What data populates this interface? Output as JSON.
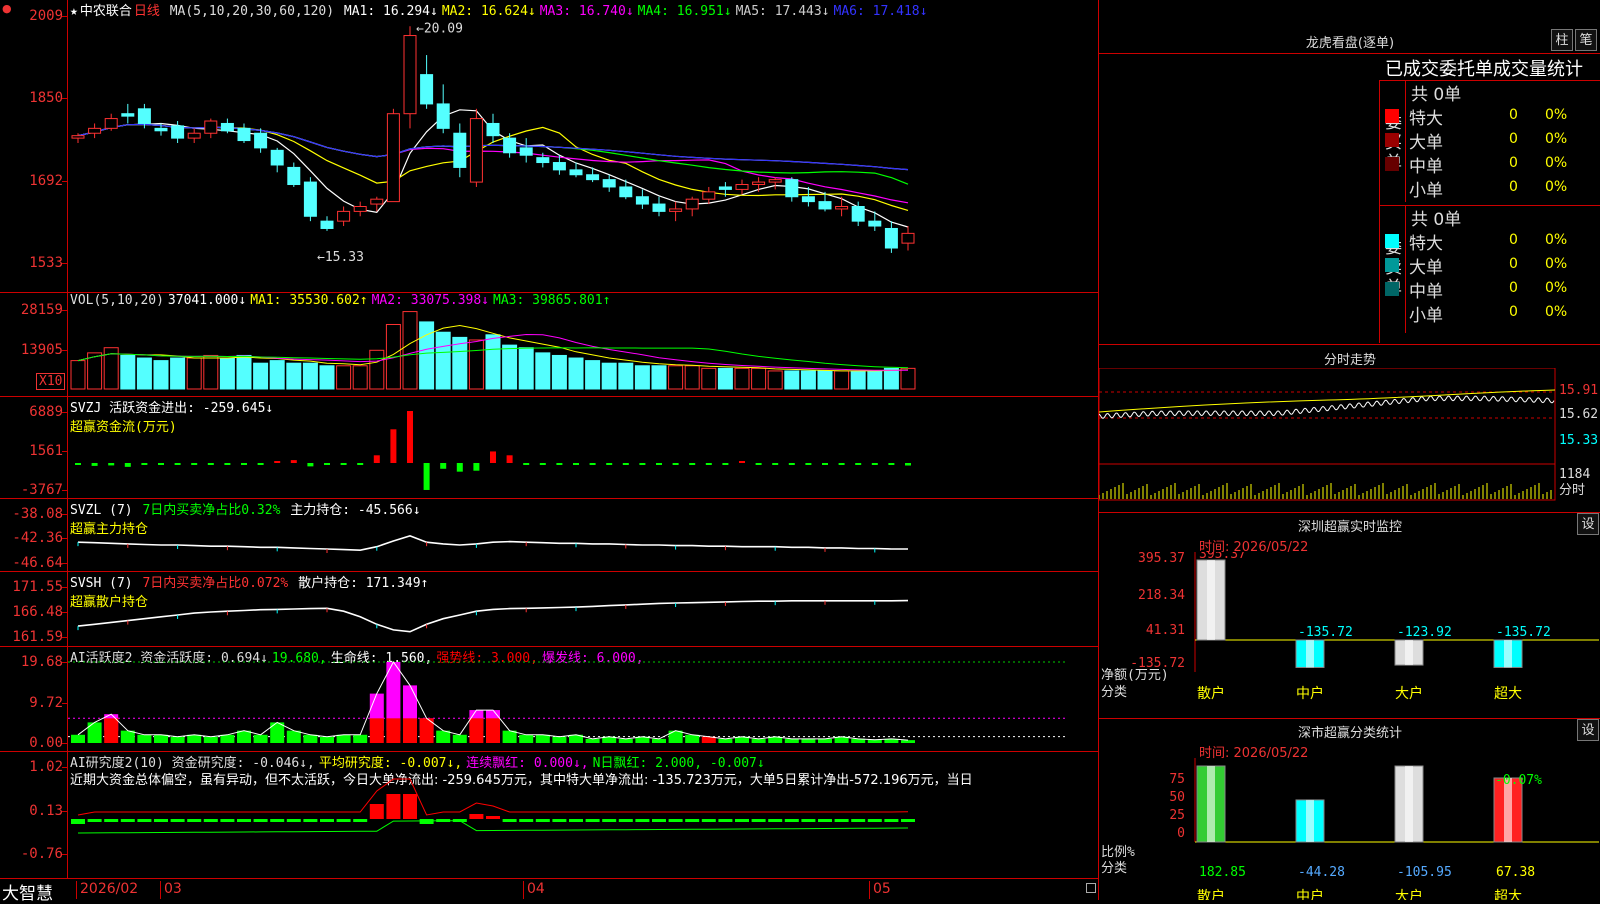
{
  "header": {
    "star": "★",
    "stock_name": "中农联合",
    "period": "日线",
    "ma_label": "MA(5,10,20,30,60,120)",
    "ma": [
      {
        "label": "MA1:",
        "value": "16.294",
        "arrow": "↓",
        "color": "#ffffff"
      },
      {
        "label": "MA2:",
        "value": "16.624",
        "arrow": "↓",
        "color": "#ffff00"
      },
      {
        "label": "MA3:",
        "value": "16.740",
        "arrow": "↓",
        "color": "#ff00ff"
      },
      {
        "label": "MA4:",
        "value": "16.951",
        "arrow": "↓",
        "color": "#00ff00"
      },
      {
        "label": "MA5:",
        "value": "17.443",
        "arrow": "↓",
        "color": "#cccccc"
      },
      {
        "label": "MA6:",
        "value": "17.418",
        "arrow": "↓",
        "color": "#3333ff"
      }
    ],
    "high_label": "20.09",
    "low_label": "15.33",
    "corner_mark": "●"
  },
  "left_axis": {
    "price": [
      "2009",
      "1850",
      "1692",
      "1533"
    ],
    "vol": [
      "28159",
      "13905"
    ],
    "vol_unit": "X10",
    "svzj": [
      "6889",
      "1561",
      "-3767"
    ],
    "svzl": [
      "-38.08",
      "-42.36",
      "-46.64"
    ],
    "svsh": [
      "171.55",
      "166.48",
      "161.59"
    ],
    "ai1": [
      "19.68",
      "9.72",
      "0.00"
    ],
    "ai2": [
      "1.02",
      "0.13",
      "-0.76"
    ]
  },
  "vol_legend": [
    {
      "text": "VOL(5,10,20)",
      "color": "#dddddd"
    },
    {
      "text": "37041.000↓",
      "color": "#ffffff"
    },
    {
      "text": "MA1: 35530.602↑",
      "color": "#ffff00"
    },
    {
      "text": "MA2: 33075.398↓",
      "color": "#ff00ff"
    },
    {
      "text": "MA3: 39865.801↑",
      "color": "#00ff00"
    }
  ],
  "svzj_legend": {
    "line1": "SVZJ  活跃资金进出: -259.645↓",
    "line2": "超赢资金流(万元)"
  },
  "svzl_legend": {
    "a": "SVZL (7)",
    "b": "7日内买卖净占比0.32%",
    "c": "主力持仓: -45.566↓",
    "line2": "超赢主力持仓"
  },
  "svsh_legend": {
    "a": "SVSH (7)",
    "b": "7日内买卖净占比0.072%",
    "c": "散户持仓: 171.349↑",
    "line2": "超赢散户持仓"
  },
  "ai1_legend": [
    {
      "text": "AI活跃度2 资金活跃度: 0.694↓",
      "color": "#dddddd"
    },
    {
      "text": "19.680,",
      "color": "#00ff00"
    },
    {
      "text": "生命线: 1.560,",
      "color": "#ffffff"
    },
    {
      "text": "强势线: 3.000,",
      "color": "#ff0000"
    },
    {
      "text": "爆发线: 6.000,",
      "color": "#ff00ff"
    }
  ],
  "ai2_legend": [
    {
      "text": "AI研究度2(10) 资金研究度: -0.046↓,",
      "color": "#dddddd"
    },
    {
      "text": "平均研究度: -0.007↓,",
      "color": "#ffff00"
    },
    {
      "text": "连续飘红: 0.000↓,",
      "color": "#ff00ff"
    },
    {
      "text": "N日飘红: 2.000, -0.007↓",
      "color": "#00ff00"
    }
  ],
  "ai2_text": "近期大资金总体偏空，虽有异动，但不太活跃，今日大单净流出: -259.645万元，其中特大单净流出: -135.723万元，大单5日累计净出-572.196万元，当日",
  "bottom": {
    "logo": "大智慧",
    "dates": [
      "2026/02",
      "03",
      "04",
      "05"
    ]
  },
  "right": {
    "title": "龙虎看盘(逐单)",
    "btn1": "柱",
    "btn2": "笔",
    "subtitle": "已成交委托单成交量统计",
    "buy": {
      "side": [
        "委",
        "买",
        "单"
      ],
      "total": "共 0单",
      "rows": [
        {
          "label": "特大",
          "val": "0",
          "pct": "0%",
          "color": "#ff0000"
        },
        {
          "label": "大单",
          "val": "0",
          "pct": "0%",
          "color": "#990000"
        },
        {
          "label": "中单",
          "val": "0",
          "pct": "0%",
          "color": "#660000"
        },
        {
          "label": "小单",
          "val": "0",
          "pct": "0%",
          "color": ""
        }
      ]
    },
    "sell": {
      "side": [
        "委",
        "卖",
        "单"
      ],
      "total": "共 0单",
      "rows": [
        {
          "label": "特大",
          "val": "0",
          "pct": "0%",
          "color": "#00ffff"
        },
        {
          "label": "大单",
          "val": "0",
          "pct": "0%",
          "color": "#009999"
        },
        {
          "label": "中单",
          "val": "0",
          "pct": "0%",
          "color": "#006666"
        },
        {
          "label": "小单",
          "val": "0",
          "pct": "0%",
          "color": ""
        }
      ]
    },
    "intraday": {
      "title": "分时走势",
      "labels": [
        "15.91",
        "15.62",
        "15.33",
        "1184",
        "分时"
      ]
    },
    "sz_monitor": {
      "title": "深圳超赢实时监控",
      "btn": "设",
      "time": "时间: 2026/05/22",
      "ylabels": [
        "395.37",
        "218.34",
        "41.31",
        "-135.72"
      ],
      "ytitle": "净额(万元)",
      "xtitle": "分类",
      "cats": [
        "散户",
        "中户",
        "大户",
        "超大"
      ],
      "values": [
        "395.37",
        "-135.72",
        "-123.92",
        "-135.72"
      ]
    },
    "sz_class": {
      "title": "深市超赢分类统计",
      "btn": "设",
      "time": "时间: 2026/05/22",
      "ylabels": [
        "75",
        "50",
        "25",
        "0"
      ],
      "ytitle": "比例%",
      "xtitle": "分类",
      "cats": [
        "散户",
        "中户",
        "大户",
        "超大"
      ],
      "values": [
        "182.85",
        "-44.28",
        "-105.95",
        "67.38"
      ],
      "top_label": "-0.07%"
    }
  },
  "chart_data": [
    {
      "type": "candlestick",
      "title": "中农联合 日线",
      "ylim": [
        15.33,
        20.09
      ],
      "note_high": 20.09,
      "note_low": 15.33,
      "ohlc": [
        [
          17.8,
          17.9,
          17.7,
          17.85
        ],
        [
          17.9,
          18.1,
          17.8,
          18.0
        ],
        [
          18.0,
          18.3,
          17.95,
          18.2
        ],
        [
          18.3,
          18.5,
          18.1,
          18.25
        ],
        [
          18.4,
          18.5,
          18.0,
          18.1
        ],
        [
          18.0,
          18.1,
          17.85,
          17.95
        ],
        [
          18.05,
          18.15,
          17.7,
          17.8
        ],
        [
          17.8,
          18.0,
          17.7,
          17.9
        ],
        [
          17.9,
          18.2,
          17.8,
          18.15
        ],
        [
          18.1,
          18.2,
          17.9,
          17.95
        ],
        [
          18.0,
          18.1,
          17.7,
          17.75
        ],
        [
          17.9,
          18.0,
          17.5,
          17.6
        ],
        [
          17.55,
          17.6,
          17.1,
          17.25
        ],
        [
          17.2,
          17.3,
          16.8,
          16.85
        ],
        [
          16.9,
          17.0,
          16.1,
          16.2
        ],
        [
          16.1,
          16.2,
          15.9,
          15.95
        ],
        [
          16.1,
          16.4,
          16.0,
          16.3
        ],
        [
          16.3,
          16.5,
          16.2,
          16.4
        ],
        [
          16.45,
          16.6,
          16.3,
          16.55
        ],
        [
          16.5,
          18.4,
          16.5,
          18.3
        ],
        [
          18.3,
          20.09,
          18.0,
          19.9
        ],
        [
          19.1,
          19.5,
          18.4,
          18.5
        ],
        [
          18.5,
          18.9,
          17.9,
          18.0
        ],
        [
          17.9,
          18.1,
          17.0,
          17.2
        ],
        [
          16.9,
          18.4,
          16.8,
          18.2
        ],
        [
          18.1,
          18.3,
          17.7,
          17.85
        ],
        [
          17.8,
          17.9,
          17.4,
          17.5
        ],
        [
          17.6,
          17.8,
          17.3,
          17.45
        ],
        [
          17.4,
          17.5,
          17.2,
          17.3
        ],
        [
          17.3,
          17.45,
          17.05,
          17.15
        ],
        [
          17.15,
          17.3,
          17.0,
          17.05
        ],
        [
          17.05,
          17.2,
          16.9,
          16.95
        ],
        [
          16.95,
          17.05,
          16.7,
          16.8
        ],
        [
          16.8,
          16.95,
          16.55,
          16.6
        ],
        [
          16.6,
          16.75,
          16.35,
          16.45
        ],
        [
          16.45,
          16.6,
          16.2,
          16.3
        ],
        [
          16.3,
          16.5,
          16.1,
          16.35
        ],
        [
          16.35,
          16.6,
          16.2,
          16.55
        ],
        [
          16.55,
          16.8,
          16.45,
          16.7
        ],
        [
          16.8,
          16.9,
          16.6,
          16.75
        ],
        [
          16.75,
          16.95,
          16.65,
          16.85
        ],
        [
          16.85,
          17.0,
          16.7,
          16.9
        ],
        [
          16.9,
          17.0,
          16.75,
          16.95
        ],
        [
          16.95,
          17.0,
          16.5,
          16.6
        ],
        [
          16.6,
          16.8,
          16.4,
          16.5
        ],
        [
          16.5,
          16.7,
          16.3,
          16.35
        ],
        [
          16.35,
          16.6,
          16.2,
          16.4
        ],
        [
          16.4,
          16.5,
          16.0,
          16.1
        ],
        [
          16.1,
          16.3,
          15.9,
          16.0
        ],
        [
          15.95,
          16.1,
          15.45,
          15.55
        ],
        [
          15.65,
          16.0,
          15.5,
          15.85
        ]
      ]
    },
    {
      "type": "bar",
      "title": "VOL",
      "values": [
        1.1,
        1.4,
        1.6,
        1.3,
        1.2,
        1.1,
        1.2,
        1.2,
        1.3,
        1.2,
        1.3,
        1.0,
        1.1,
        1.0,
        1.0,
        0.9,
        0.9,
        0.9,
        1.5,
        2.5,
        3.0,
        2.6,
        2.2,
        2.0,
        1.9,
        2.1,
        1.7,
        1.6,
        1.4,
        1.3,
        1.2,
        1.1,
        1.0,
        1.0,
        0.9,
        0.9,
        0.9,
        0.9,
        0.8,
        0.8,
        0.8,
        0.8,
        0.7,
        0.7,
        0.7,
        0.7,
        0.7,
        0.7,
        0.7,
        0.8,
        0.8
      ]
    },
    {
      "type": "bar",
      "title": "SVZJ",
      "values": [
        -200,
        -300,
        -250,
        -400,
        -50,
        -30,
        -60,
        -80,
        -40,
        -50,
        -20,
        -30,
        100,
        300,
        -350,
        -200,
        -150,
        -100,
        800,
        3500,
        5400,
        -2800,
        -600,
        -900,
        -800,
        1200,
        800,
        -200,
        -100,
        -150,
        -50,
        -100,
        -50,
        -80,
        -60,
        -50,
        -40,
        -60,
        -20,
        -30,
        100,
        -40,
        -50,
        -30,
        -60,
        -40,
        -50,
        -30,
        -20,
        -40,
        -259.6
      ]
    },
    {
      "type": "line",
      "title": "SVZL",
      "values": [
        -43.0,
        -43.1,
        -43.2,
        -43.3,
        -43.4,
        -43.5,
        -43.5,
        -43.6,
        -43.7,
        -43.7,
        -43.8,
        -43.9,
        -43.9,
        -44.0,
        -44.1,
        -44.2,
        -44.3,
        -44.4,
        -43.8,
        -42.8,
        -41.9,
        -43.0,
        -43.3,
        -43.5,
        -43.3,
        -43.0,
        -42.9,
        -43.0,
        -43.1,
        -43.2,
        -43.2,
        -43.3,
        -43.3,
        -43.4,
        -43.5,
        -43.5,
        -43.6,
        -43.6,
        -43.7,
        -43.7,
        -43.8,
        -43.8,
        -43.8,
        -43.9,
        -43.9,
        -44.0,
        -44.0,
        -44.1,
        -44.1,
        -44.2,
        -44.2
      ]
    },
    {
      "type": "line",
      "title": "SVSH",
      "values": [
        164.5,
        165.0,
        165.5,
        166.0,
        166.5,
        167.0,
        167.5,
        168.0,
        168.3,
        168.5,
        168.7,
        168.9,
        169.0,
        169.1,
        169.2,
        169.3,
        168.5,
        167.0,
        165.0,
        163.5,
        163.0,
        165.0,
        166.5,
        167.5,
        168.5,
        169.0,
        169.2,
        169.3,
        169.4,
        169.5,
        169.6,
        169.8,
        170.0,
        170.2,
        170.4,
        170.6,
        170.7,
        170.8,
        170.9,
        171.0,
        171.1,
        171.2,
        171.2,
        171.3,
        171.3,
        171.3,
        171.3,
        171.3,
        171.3,
        171.3,
        171.35
      ]
    },
    {
      "type": "bar",
      "title": "AI活跃度2",
      "values": [
        2,
        5,
        7,
        3,
        2,
        2,
        1.5,
        2,
        1.5,
        2,
        3,
        2,
        5,
        3,
        2,
        1.5,
        2,
        2,
        12,
        19.68,
        14,
        6,
        3,
        2,
        8,
        8,
        3,
        2,
        2,
        1.5,
        2,
        1,
        1.5,
        1,
        1.5,
        1,
        3,
        2,
        1.5,
        1,
        1.5,
        1,
        1.5,
        1,
        1,
        1,
        1.5,
        1,
        0.8,
        1,
        0.694
      ]
    },
    {
      "type": "bar",
      "title": "AI研究度2",
      "values": [
        -0.1,
        -0.05,
        -0.05,
        -0.05,
        -0.05,
        -0.05,
        -0.05,
        -0.05,
        -0.05,
        -0.05,
        -0.05,
        -0.05,
        -0.05,
        -0.05,
        -0.05,
        -0.05,
        -0.05,
        -0.05,
        0.3,
        0.5,
        0.5,
        -0.1,
        -0.05,
        -0.05,
        0.1,
        0.05,
        -0.05,
        -0.05,
        -0.05,
        -0.05,
        -0.05,
        -0.05,
        -0.05,
        -0.05,
        -0.05,
        -0.05,
        -0.05,
        -0.05,
        -0.05,
        -0.05,
        -0.05,
        -0.05,
        -0.05,
        -0.05,
        -0.05,
        -0.05,
        -0.05,
        -0.05,
        -0.05,
        -0.05,
        -0.046
      ]
    }
  ]
}
